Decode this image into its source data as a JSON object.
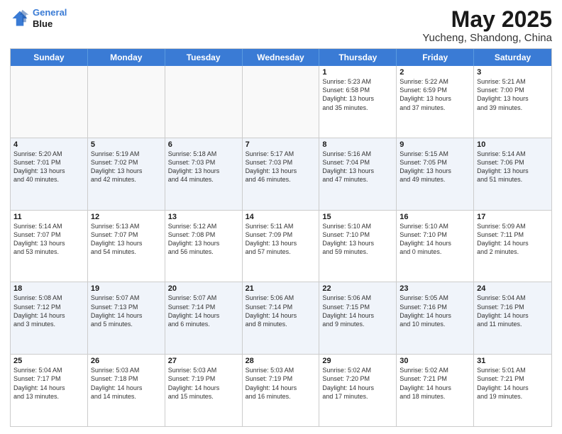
{
  "logo": {
    "line1": "General",
    "line2": "Blue"
  },
  "title": "May 2025",
  "subtitle": "Yucheng, Shandong, China",
  "days": [
    "Sunday",
    "Monday",
    "Tuesday",
    "Wednesday",
    "Thursday",
    "Friday",
    "Saturday"
  ],
  "rows": [
    [
      {
        "day": "",
        "info": ""
      },
      {
        "day": "",
        "info": ""
      },
      {
        "day": "",
        "info": ""
      },
      {
        "day": "",
        "info": ""
      },
      {
        "day": "1",
        "info": "Sunrise: 5:23 AM\nSunset: 6:58 PM\nDaylight: 13 hours\nand 35 minutes."
      },
      {
        "day": "2",
        "info": "Sunrise: 5:22 AM\nSunset: 6:59 PM\nDaylight: 13 hours\nand 37 minutes."
      },
      {
        "day": "3",
        "info": "Sunrise: 5:21 AM\nSunset: 7:00 PM\nDaylight: 13 hours\nand 39 minutes."
      }
    ],
    [
      {
        "day": "4",
        "info": "Sunrise: 5:20 AM\nSunset: 7:01 PM\nDaylight: 13 hours\nand 40 minutes."
      },
      {
        "day": "5",
        "info": "Sunrise: 5:19 AM\nSunset: 7:02 PM\nDaylight: 13 hours\nand 42 minutes."
      },
      {
        "day": "6",
        "info": "Sunrise: 5:18 AM\nSunset: 7:03 PM\nDaylight: 13 hours\nand 44 minutes."
      },
      {
        "day": "7",
        "info": "Sunrise: 5:17 AM\nSunset: 7:03 PM\nDaylight: 13 hours\nand 46 minutes."
      },
      {
        "day": "8",
        "info": "Sunrise: 5:16 AM\nSunset: 7:04 PM\nDaylight: 13 hours\nand 47 minutes."
      },
      {
        "day": "9",
        "info": "Sunrise: 5:15 AM\nSunset: 7:05 PM\nDaylight: 13 hours\nand 49 minutes."
      },
      {
        "day": "10",
        "info": "Sunrise: 5:14 AM\nSunset: 7:06 PM\nDaylight: 13 hours\nand 51 minutes."
      }
    ],
    [
      {
        "day": "11",
        "info": "Sunrise: 5:14 AM\nSunset: 7:07 PM\nDaylight: 13 hours\nand 53 minutes."
      },
      {
        "day": "12",
        "info": "Sunrise: 5:13 AM\nSunset: 7:07 PM\nDaylight: 13 hours\nand 54 minutes."
      },
      {
        "day": "13",
        "info": "Sunrise: 5:12 AM\nSunset: 7:08 PM\nDaylight: 13 hours\nand 56 minutes."
      },
      {
        "day": "14",
        "info": "Sunrise: 5:11 AM\nSunset: 7:09 PM\nDaylight: 13 hours\nand 57 minutes."
      },
      {
        "day": "15",
        "info": "Sunrise: 5:10 AM\nSunset: 7:10 PM\nDaylight: 13 hours\nand 59 minutes."
      },
      {
        "day": "16",
        "info": "Sunrise: 5:10 AM\nSunset: 7:10 PM\nDaylight: 14 hours\nand 0 minutes."
      },
      {
        "day": "17",
        "info": "Sunrise: 5:09 AM\nSunset: 7:11 PM\nDaylight: 14 hours\nand 2 minutes."
      }
    ],
    [
      {
        "day": "18",
        "info": "Sunrise: 5:08 AM\nSunset: 7:12 PM\nDaylight: 14 hours\nand 3 minutes."
      },
      {
        "day": "19",
        "info": "Sunrise: 5:07 AM\nSunset: 7:13 PM\nDaylight: 14 hours\nand 5 minutes."
      },
      {
        "day": "20",
        "info": "Sunrise: 5:07 AM\nSunset: 7:14 PM\nDaylight: 14 hours\nand 6 minutes."
      },
      {
        "day": "21",
        "info": "Sunrise: 5:06 AM\nSunset: 7:14 PM\nDaylight: 14 hours\nand 8 minutes."
      },
      {
        "day": "22",
        "info": "Sunrise: 5:06 AM\nSunset: 7:15 PM\nDaylight: 14 hours\nand 9 minutes."
      },
      {
        "day": "23",
        "info": "Sunrise: 5:05 AM\nSunset: 7:16 PM\nDaylight: 14 hours\nand 10 minutes."
      },
      {
        "day": "24",
        "info": "Sunrise: 5:04 AM\nSunset: 7:16 PM\nDaylight: 14 hours\nand 11 minutes."
      }
    ],
    [
      {
        "day": "25",
        "info": "Sunrise: 5:04 AM\nSunset: 7:17 PM\nDaylight: 14 hours\nand 13 minutes."
      },
      {
        "day": "26",
        "info": "Sunrise: 5:03 AM\nSunset: 7:18 PM\nDaylight: 14 hours\nand 14 minutes."
      },
      {
        "day": "27",
        "info": "Sunrise: 5:03 AM\nSunset: 7:19 PM\nDaylight: 14 hours\nand 15 minutes."
      },
      {
        "day": "28",
        "info": "Sunrise: 5:03 AM\nSunset: 7:19 PM\nDaylight: 14 hours\nand 16 minutes."
      },
      {
        "day": "29",
        "info": "Sunrise: 5:02 AM\nSunset: 7:20 PM\nDaylight: 14 hours\nand 17 minutes."
      },
      {
        "day": "30",
        "info": "Sunrise: 5:02 AM\nSunset: 7:21 PM\nDaylight: 14 hours\nand 18 minutes."
      },
      {
        "day": "31",
        "info": "Sunrise: 5:01 AM\nSunset: 7:21 PM\nDaylight: 14 hours\nand 19 minutes."
      }
    ]
  ]
}
